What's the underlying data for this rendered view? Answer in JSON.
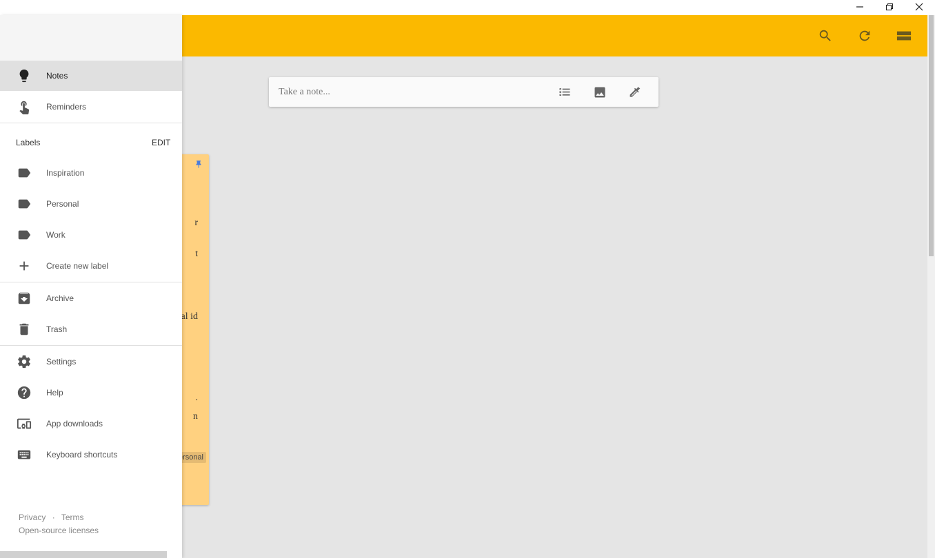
{
  "window": {
    "minimize_icon": "minimize-icon",
    "restore_icon": "restore-icon",
    "close_icon": "close-icon"
  },
  "header": {
    "bg_color": "#fbb900",
    "icons": [
      "search-icon",
      "refresh-icon",
      "list-view-icon"
    ]
  },
  "drawer": {
    "nav": [
      {
        "label": "Notes",
        "icon": "lightbulb-icon",
        "active": true
      },
      {
        "label": "Reminders",
        "icon": "reminder-hand-icon",
        "active": false
      }
    ],
    "labels_heading": "Labels",
    "labels_edit": "EDIT",
    "labels": [
      {
        "label": "Inspiration",
        "icon": "label-icon"
      },
      {
        "label": "Personal",
        "icon": "label-icon"
      },
      {
        "label": "Work",
        "icon": "label-icon"
      }
    ],
    "create_label": "Create new label",
    "secondary": [
      {
        "label": "Archive",
        "icon": "archive-icon"
      },
      {
        "label": "Trash",
        "icon": "trash-icon"
      }
    ],
    "tertiary": [
      {
        "label": "Settings",
        "icon": "gear-icon"
      },
      {
        "label": "Help",
        "icon": "help-icon"
      },
      {
        "label": "App downloads",
        "icon": "devices-icon"
      },
      {
        "label": "Keyboard shortcuts",
        "icon": "keyboard-icon"
      }
    ],
    "footer": {
      "privacy": "Privacy",
      "separator": "·",
      "terms": "Terms",
      "licenses": "Open-source licenses"
    }
  },
  "main": {
    "note_input": {
      "placeholder": "Take a note...",
      "icons": [
        "checklist-icon",
        "image-icon",
        "drawing-icon"
      ]
    },
    "note_card": {
      "bg_color": "#ffd180",
      "fragments": [
        "r",
        "t",
        "al id",
        ".",
        "n"
      ],
      "label_chip": "ersonal"
    }
  }
}
